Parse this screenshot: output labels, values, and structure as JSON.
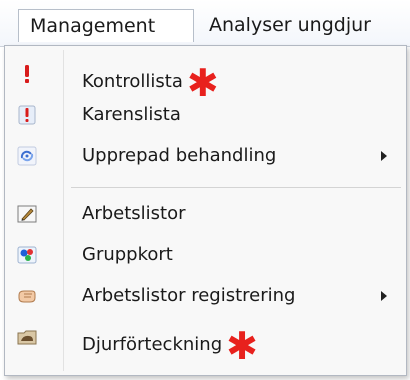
{
  "menubar": {
    "active": "Management",
    "other": "Analyser ungdjur"
  },
  "menu": {
    "items": [
      {
        "label": "Kontrollista",
        "icon": "exclamation-icon",
        "marked": true,
        "submenu": false
      },
      {
        "label": "Karenslista",
        "icon": "exclamation-flag-icon",
        "marked": false,
        "submenu": false
      },
      {
        "label": "Upprepad behandling",
        "icon": "repeat-treatment-icon",
        "marked": false,
        "submenu": true
      },
      {
        "label": "Arbetslistor",
        "icon": "pen-list-icon",
        "marked": false,
        "submenu": false
      },
      {
        "label": "Gruppkort",
        "icon": "group-dots-icon",
        "marked": false,
        "submenu": false
      },
      {
        "label": "Arbetslistor registrering",
        "icon": "hand-register-icon",
        "marked": false,
        "submenu": true
      },
      {
        "label": "Djurförteckning",
        "icon": "folder-cow-icon",
        "marked": true,
        "submenu": false
      }
    ],
    "asterisk": "✱",
    "colors": {
      "asterisk": "#e8211d",
      "exclamation": "#d81c1c"
    }
  }
}
